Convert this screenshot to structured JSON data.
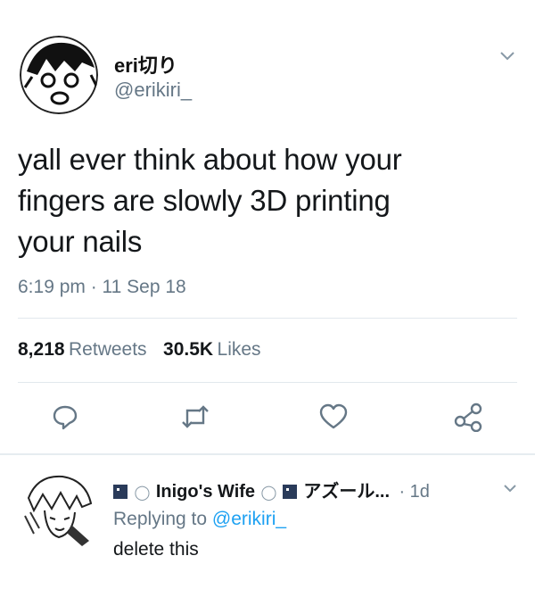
{
  "tweet": {
    "display_name": "eri切り",
    "handle": "@erikiri_",
    "text_lines": [
      "yall ever think about how your",
      "fingers are slowly 3D printing",
      "your nails"
    ],
    "timestamp": "6:19 pm · 11 Sep 18",
    "retweets_count": "8,218",
    "retweets_label": "Retweets",
    "likes_count": "30.5K",
    "likes_label": "Likes"
  },
  "actions": {
    "reply_icon": "reply-icon",
    "retweet_icon": "retweet-icon",
    "like_icon": "heart-icon",
    "share_icon": "share-icon"
  },
  "reply": {
    "display_name": "Inigo's Wife",
    "name_suffix": "アズール...",
    "age": "· 1d",
    "replying_prefix": "Replying to",
    "replying_handle": "@erikiri_",
    "text": "delete this"
  },
  "colors": {
    "link": "#1da1f2",
    "secondary_text": "#657786",
    "divider": "#e1e8ed"
  }
}
